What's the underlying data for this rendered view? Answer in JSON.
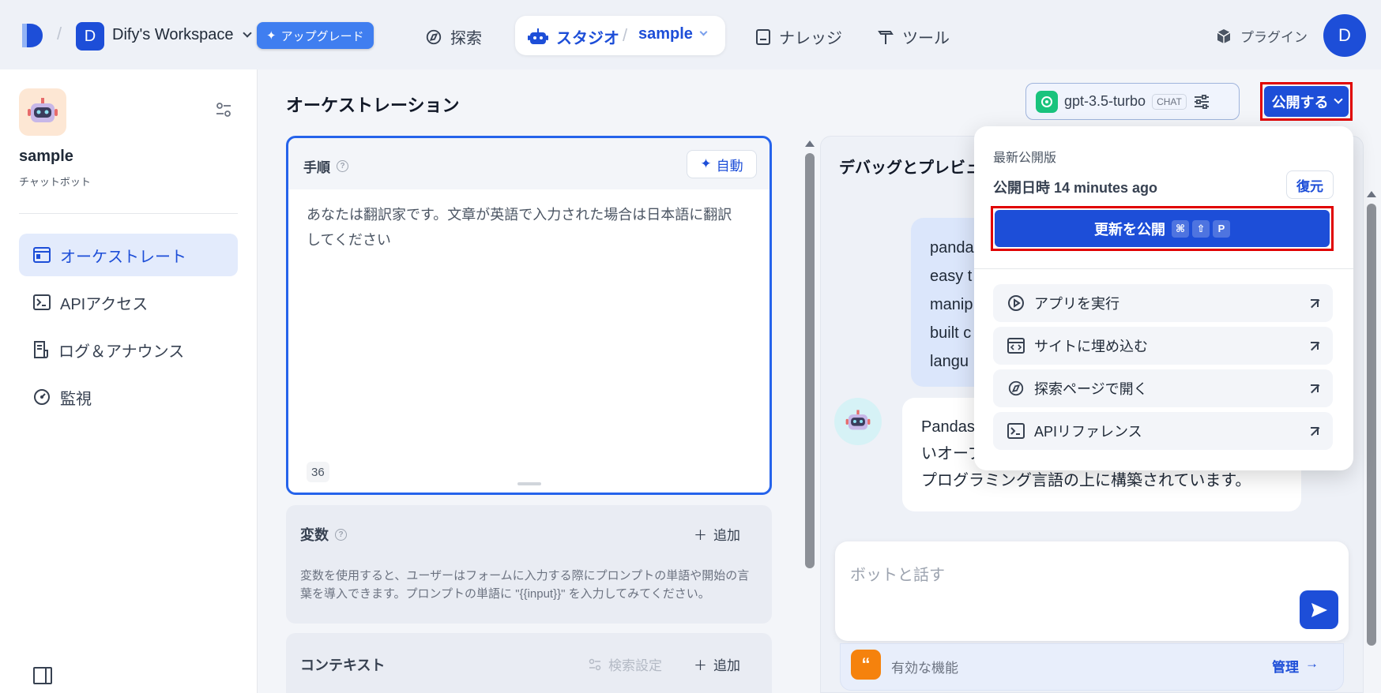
{
  "header": {
    "workspace_initial": "D",
    "workspace_name": "Dify's Workspace",
    "upgrade_label": "アップグレード",
    "nav_explore": "探索",
    "nav_studio": "スタジオ",
    "app_selector": "sample",
    "nav_knowledge": "ナレッジ",
    "nav_tools": "ツール",
    "plugins": "プラグイン",
    "user_initial": "D"
  },
  "sidebar": {
    "app_name": "sample",
    "app_type": "チャットボット",
    "items": [
      {
        "label": "オーケストレート",
        "active": true
      },
      {
        "label": "APIアクセス"
      },
      {
        "label": "ログ＆アナウンス"
      },
      {
        "label": "監視"
      }
    ]
  },
  "orchestration": {
    "title": "オーケストレーション",
    "model_name": "gpt-3.5-turbo",
    "model_mode": "CHAT",
    "publish_label": "公開する",
    "instructions_label": "手順",
    "auto_label": "自動",
    "prompt_text": "あなたは翻訳家です。文章が英語で入力された場合は日本語に翻訳してください",
    "char_count": "36",
    "variables_label": "変数",
    "add_label": "追加",
    "variables_desc": "変数を使用すると、ユーザーはフォームに入力する際にプロンプトの単語や開始の言葉を導入できます。プロンプトの単語に \"{{input}}\" を入力してみてください。",
    "context_label": "コンテキスト",
    "retrieval_settings": "検索設定",
    "context_add": "追加"
  },
  "debug": {
    "title": "デバッグとプレビュー",
    "user_lines": [
      "panda",
      "easy t",
      "manip",
      "built c",
      "langu"
    ],
    "bot_lines": [
      "Pandas",
      "いオープ",
      "プログラミング言語の上に構築されています。"
    ],
    "input_placeholder": "ボットと話す",
    "features_label": "有効な機能",
    "manage_label": "管理"
  },
  "publish_dropdown": {
    "latest_label": "最新公開版",
    "published_at": "公開日時 14 minutes ago",
    "restore_label": "復元",
    "update_label": "更新を公開",
    "shortcut": [
      "⌘",
      "⇧",
      "P"
    ],
    "actions": [
      "アプリを実行",
      "サイトに埋め込む",
      "探索ページで開く",
      "APIリファレンス"
    ]
  },
  "colors": {
    "primary": "#1d4ed8",
    "highlight": "#e00000"
  }
}
